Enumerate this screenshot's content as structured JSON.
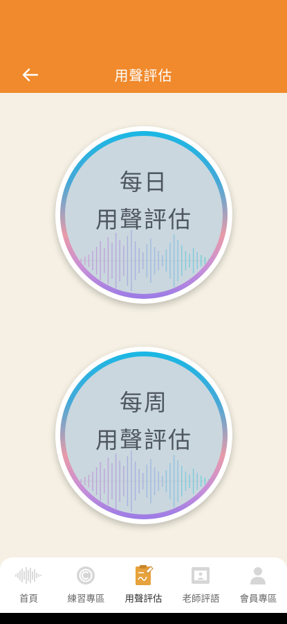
{
  "header": {
    "title": "用聲評估",
    "back_icon": "arrow-left-icon"
  },
  "cards": [
    {
      "line1": "每日",
      "line2": "用聲評估"
    },
    {
      "line1": "每周",
      "line2": "用聲評估"
    }
  ],
  "tabs": [
    {
      "label": "首頁",
      "icon": "waveform-icon",
      "active": false
    },
    {
      "label": "練習專區",
      "icon": "target-icon",
      "active": false
    },
    {
      "label": "用聲評估",
      "icon": "clipboard-pen-icon",
      "active": true
    },
    {
      "label": "老師評語",
      "icon": "chalkboard-icon",
      "active": false
    },
    {
      "label": "會員專區",
      "icon": "person-icon",
      "active": false
    }
  ],
  "colors": {
    "header": "#f08a2c",
    "background": "#f5f0e3",
    "active_tab_icon": "#e6a23c",
    "inactive_tab_icon": "#c9c9c9"
  }
}
